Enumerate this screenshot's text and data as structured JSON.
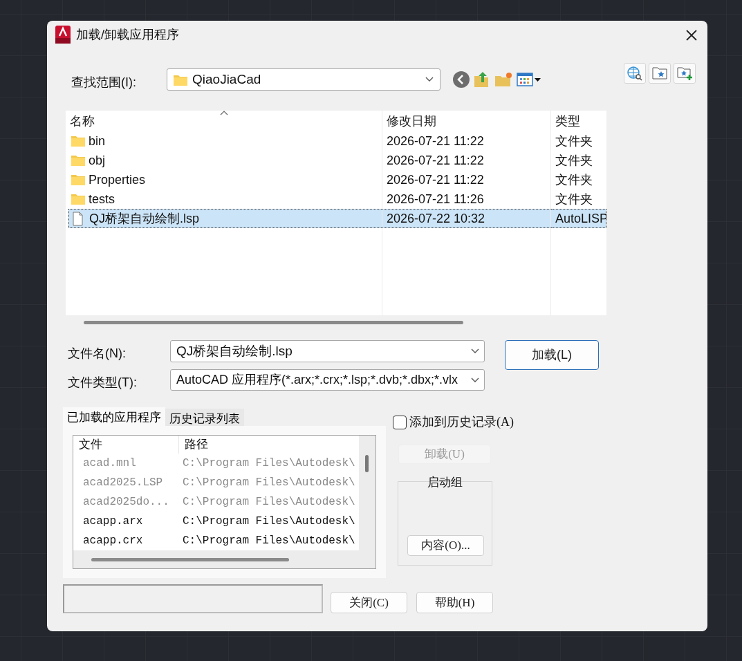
{
  "window": {
    "title": "加载/卸载应用程序"
  },
  "look_in": {
    "label": "查找范围(I):",
    "value": "QiaoJiaCad"
  },
  "file_list": {
    "columns": [
      {
        "label": "名称",
        "sorted": true
      },
      {
        "label": "修改日期",
        "sorted": false
      },
      {
        "label": "类型",
        "sorted": false
      }
    ],
    "rows": [
      {
        "name": "bin",
        "kind": "folder",
        "modified": "2026-07-21 11:22",
        "type": "文件夹",
        "selected": false
      },
      {
        "name": "obj",
        "kind": "folder",
        "modified": "2026-07-21 11:22",
        "type": "文件夹",
        "selected": false
      },
      {
        "name": "Properties",
        "kind": "folder",
        "modified": "2026-07-21 11:22",
        "type": "文件夹",
        "selected": false
      },
      {
        "name": "tests",
        "kind": "folder",
        "modified": "2026-07-21 11:26",
        "type": "文件夹",
        "selected": false
      },
      {
        "name": "QJ桥架自动绘制.lsp",
        "kind": "file",
        "modified": "2026-07-22 10:32",
        "type": "AutoLISP",
        "selected": true
      }
    ]
  },
  "file_name": {
    "label": "文件名(N):",
    "value": "QJ桥架自动绘制.lsp"
  },
  "file_type": {
    "label": "文件类型(T):",
    "value": "AutoCAD 应用程序(*.arx;*.crx;*.lsp;*.dvb;*.dbx;*.vlx"
  },
  "load_button": "加载(L)",
  "tabs": [
    {
      "label": "已加载的应用程序",
      "selected": true
    },
    {
      "label": "历史记录列表",
      "selected": false
    }
  ],
  "loaded_apps": {
    "columns": [
      "文件",
      "路径"
    ],
    "rows": [
      {
        "file": "acad.mnl",
        "path": "C:\\Program Files\\Autodesk\\",
        "dimmed": true
      },
      {
        "file": "acad2025.LSP",
        "path": "C:\\Program Files\\Autodesk\\",
        "dimmed": true
      },
      {
        "file": "acad2025do...",
        "path": "C:\\Program Files\\Autodesk\\",
        "dimmed": true
      },
      {
        "file": "acapp.arx",
        "path": "C:\\Program Files\\Autodesk\\",
        "dimmed": false
      },
      {
        "file": "acapp.crx",
        "path": "C:\\Program Files\\Autodesk\\",
        "dimmed": false
      }
    ]
  },
  "add_to_history": {
    "label": "添加到历史记录(A)",
    "checked": false
  },
  "unload_button": {
    "label": "卸载(U)",
    "disabled": true
  },
  "startup_group": {
    "title": "启动组",
    "button": "内容(O)..."
  },
  "close_button": "关闭(C)",
  "help_button": "帮助(H)"
}
